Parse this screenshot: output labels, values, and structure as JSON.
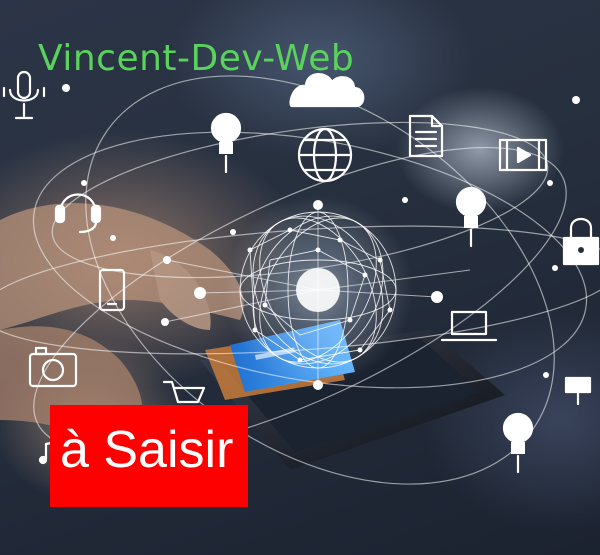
{
  "brand": {
    "title": "Vincent-Dev-Web",
    "color": "#59d35c"
  },
  "banner": {
    "text": "à Saisir",
    "background": "#ff0000",
    "color": "#ffffff"
  },
  "icons": [
    "microphone-icon",
    "cloud-icon",
    "lightbulb-icon",
    "globe-icon",
    "document-icon",
    "video-icon",
    "headset-icon",
    "lightbulb-icon",
    "lock-icon",
    "smartphone-icon",
    "laptop-icon",
    "camera-icon",
    "shopping-cart-icon",
    "security-camera-icon",
    "lightbulb-icon",
    "music-note-icon"
  ]
}
